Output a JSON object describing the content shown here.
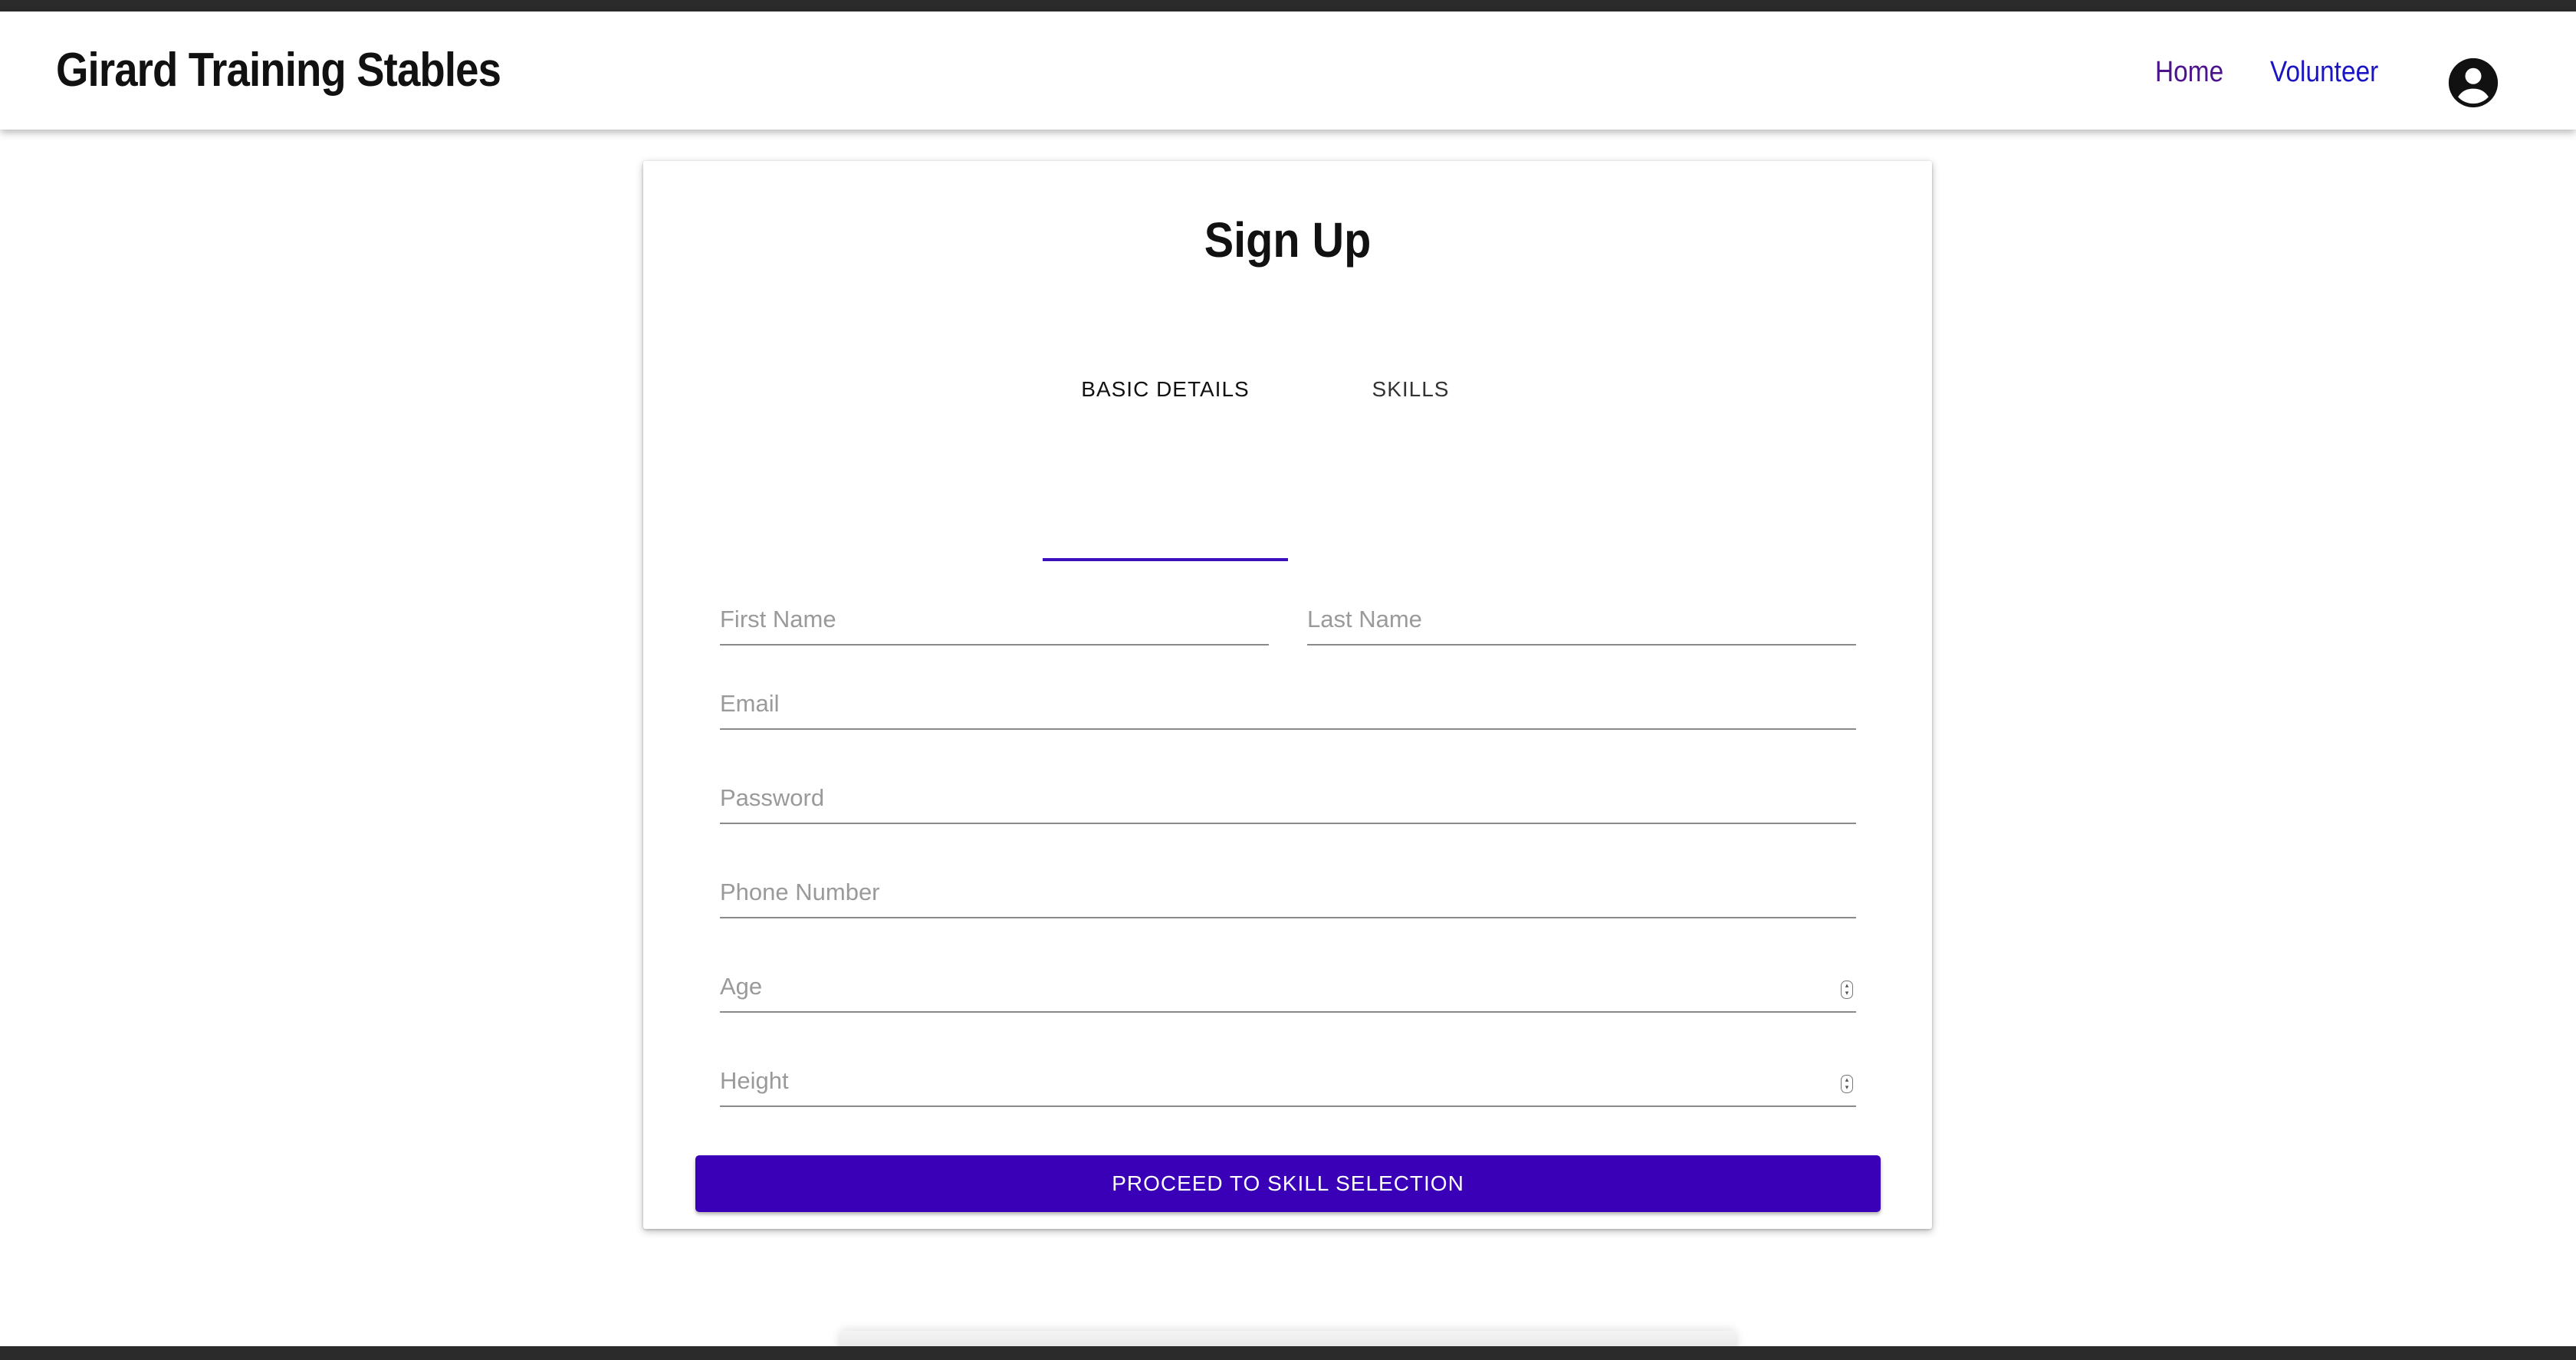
{
  "app": {
    "brand": "Girard Training Stables",
    "nav": {
      "home": "Home",
      "volunteer": "Volunteer"
    }
  },
  "signup": {
    "title": "Sign Up",
    "tabs": [
      {
        "label": "BASIC DETAILS",
        "active": true
      },
      {
        "label": "SKILLS",
        "active": false
      }
    ],
    "fields": {
      "first_name": {
        "placeholder": "First Name",
        "value": ""
      },
      "last_name": {
        "placeholder": "Last Name",
        "value": ""
      },
      "email": {
        "placeholder": "Email",
        "value": ""
      },
      "password": {
        "placeholder": "Password",
        "value": ""
      },
      "phone": {
        "placeholder": "Phone Number",
        "value": ""
      },
      "age": {
        "placeholder": "Age",
        "value": ""
      },
      "height": {
        "placeholder": "Height",
        "value": ""
      }
    },
    "primary_button": "PROCEED TO SKILL SELECTION"
  },
  "icons": {
    "account": "account-circle-icon",
    "spinner": "number-spinner-icon"
  },
  "colors": {
    "accent": "#3a00b8",
    "tab_indicator": "#3a0fbd",
    "home_link": "#4b148c",
    "volunteer_link": "#1a14c4"
  }
}
